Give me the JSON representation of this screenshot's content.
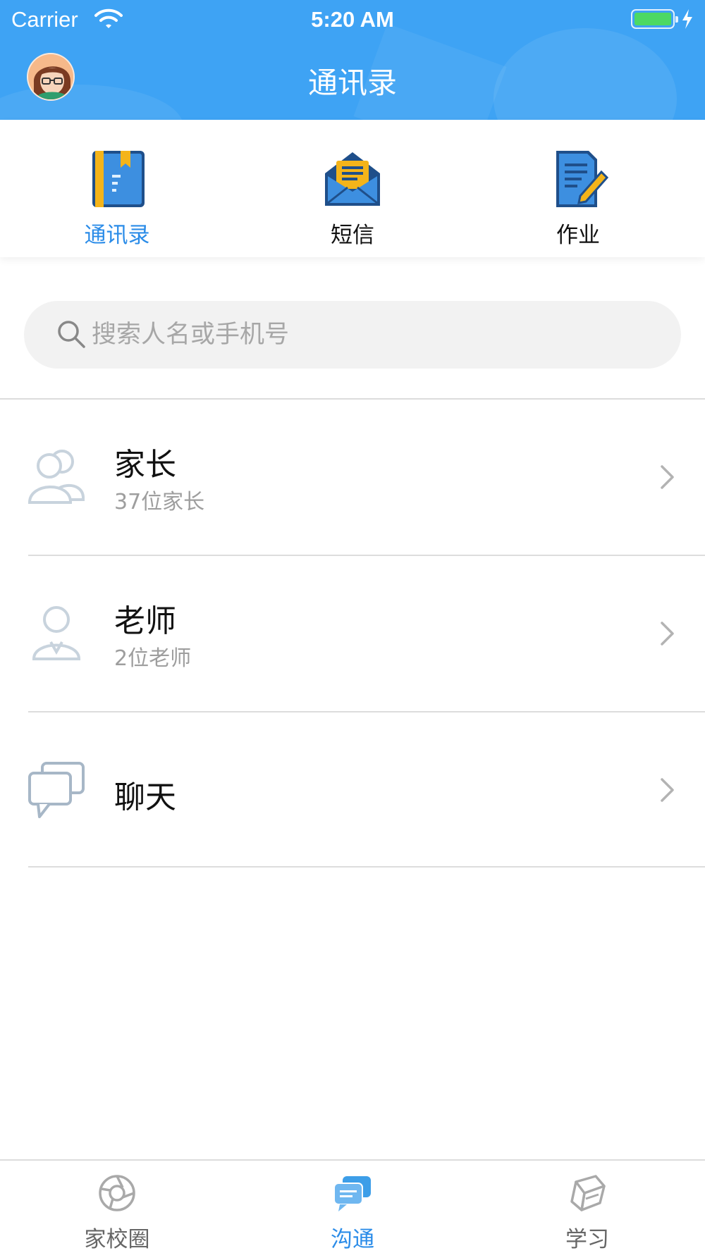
{
  "status_bar": {
    "carrier": "Carrier",
    "time": "5:20 AM"
  },
  "nav": {
    "title": "通讯录"
  },
  "top_tabs": [
    {
      "label": "通讯录",
      "icon": "address-book-icon",
      "active": true
    },
    {
      "label": "短信",
      "icon": "envelope-icon",
      "active": false
    },
    {
      "label": "作业",
      "icon": "homework-icon",
      "active": false
    }
  ],
  "search": {
    "placeholder": "搜索人名或手机号",
    "value": ""
  },
  "list": [
    {
      "title": "家长",
      "subtitle": "37位家长",
      "icon": "parents-group-icon"
    },
    {
      "title": "老师",
      "subtitle": "2位老师",
      "icon": "teacher-icon"
    },
    {
      "title": "聊天",
      "icon": "chat-bubbles-icon"
    }
  ],
  "bottom_tabs": [
    {
      "label": "家校圈",
      "icon": "circle-lens-icon",
      "active": false
    },
    {
      "label": "沟通",
      "icon": "chat-icon",
      "active": true
    },
    {
      "label": "学习",
      "icon": "book-icon",
      "active": false
    }
  ],
  "colors": {
    "header_bg": "#3ea3f4",
    "accent": "#2b8ce8",
    "battery": "#4cd964"
  }
}
